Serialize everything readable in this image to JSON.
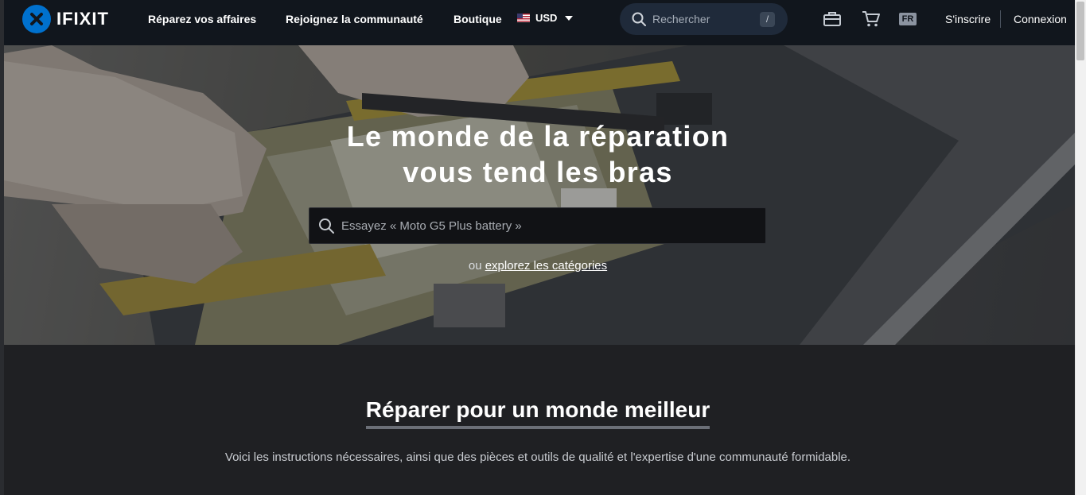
{
  "header": {
    "logo_text": "IFIXIT",
    "nav": {
      "repair": "Réparez vos affaires",
      "community": "Rejoignez la communauté",
      "store": "Boutique"
    },
    "currency": "USD",
    "search_placeholder": "Rechercher",
    "search_shortcut": "/",
    "language": "FR",
    "signup": "S'inscrire",
    "login": "Connexion"
  },
  "hero": {
    "title_line1": "Le monde de la réparation",
    "title_line2": "vous tend les bras",
    "search_placeholder": "Essayez « Moto G5 Plus battery »",
    "explore_prefix": "ou ",
    "explore_link": "explorez les catégories"
  },
  "section": {
    "title": "Réparer pour un monde meilleur",
    "text": "Voici les instructions nécessaires, ainsi que des pièces et outils de qualité et l'expertise d'une communauté formidable."
  },
  "colors": {
    "header_bg": "#11161d",
    "brand_blue": "#0071ce",
    "section_bg": "#1f2023"
  }
}
